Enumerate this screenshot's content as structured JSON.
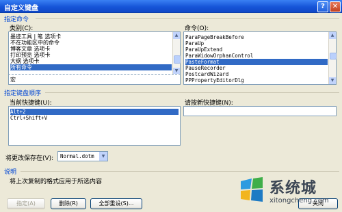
{
  "window": {
    "title": "自定义键盘",
    "help_glyph": "?",
    "close_glyph": "✕"
  },
  "specify_command": {
    "section_label": "指定命令",
    "categories_label": "类别(C):",
    "categories": [
      "墨迹工具 | 笔 选项卡",
      "不在功能区中的命令",
      "博客文章 选项卡",
      "打印预览 选项卡",
      "大纲 选项卡",
      "所有命令"
    ],
    "categories_selected_index": 5,
    "categories_extra": "宏",
    "commands_label": "命令(O):",
    "commands": [
      "ParaPageBreakBefore",
      "ParaUp",
      "ParaUpExtend",
      "ParaWidowOrphanControl",
      "PasteFormat",
      "PauseRecorder",
      "PostcardWizard",
      "PPPropertyEditorDlg"
    ],
    "commands_selected_index": 4
  },
  "shortcut": {
    "section_label": "指定键盘顺序",
    "current_label": "当前快捷键(U):",
    "current_keys": [
      "Alt+2",
      "Ctrl+Shift+V"
    ],
    "current_selected_index": 0,
    "new_label": "请按新快捷键(N):",
    "new_value": ""
  },
  "save_in": {
    "label": "将更改保存在(V):",
    "value": "Normal.dotm"
  },
  "description": {
    "section_label": "说明",
    "text": "将上次复制的格式应用于所选内容"
  },
  "buttons": {
    "assign": "指定(A)",
    "remove": "删除(R)",
    "reset_all": "全部重设(S)...",
    "close": "关闭"
  },
  "watermark": {
    "cn": "系统城",
    "en": "xitongcheng.com"
  },
  "colors": {
    "title_bar": "#1655D8",
    "selection": "#316AC5",
    "section_text": "#0046D5",
    "dialog_bg": "#ECE9D8"
  }
}
